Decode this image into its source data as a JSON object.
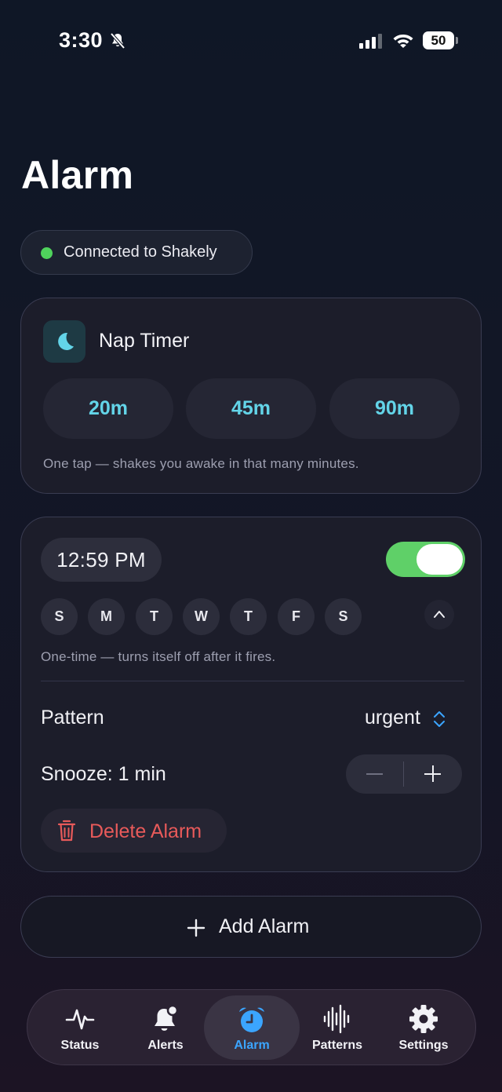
{
  "status_bar": {
    "time": "3:30",
    "battery": "50"
  },
  "page_title": "Alarm",
  "connection": {
    "label": "Connected to Shakely",
    "status_color": "#4fd35c"
  },
  "nap_timer": {
    "title": "Nap Timer",
    "options": [
      "20m",
      "45m",
      "90m"
    ],
    "caption": "One tap — shakes you awake in that many minutes."
  },
  "alarm": {
    "time": "12:59 PM",
    "enabled": true,
    "days": [
      "S",
      "M",
      "T",
      "W",
      "T",
      "F",
      "S"
    ],
    "caption": "One-time — turns itself off after it fires.",
    "pattern_label": "Pattern",
    "pattern_value": "urgent",
    "snooze_label": "Snooze: 1 min",
    "delete_label": "Delete Alarm"
  },
  "add_alarm_label": "Add Alarm",
  "tabs": [
    {
      "label": "Status",
      "icon": "heartbeat-icon"
    },
    {
      "label": "Alerts",
      "icon": "bell-badge-icon"
    },
    {
      "label": "Alarm",
      "icon": "alarm-clock-icon",
      "active": true
    },
    {
      "label": "Patterns",
      "icon": "waveform-icon"
    },
    {
      "label": "Settings",
      "icon": "gear-icon"
    }
  ],
  "colors": {
    "accent": "#3ba5ff",
    "nap_accent": "#63d4e8",
    "toggle_on": "#5fd068",
    "danger": "#e85a5a"
  }
}
